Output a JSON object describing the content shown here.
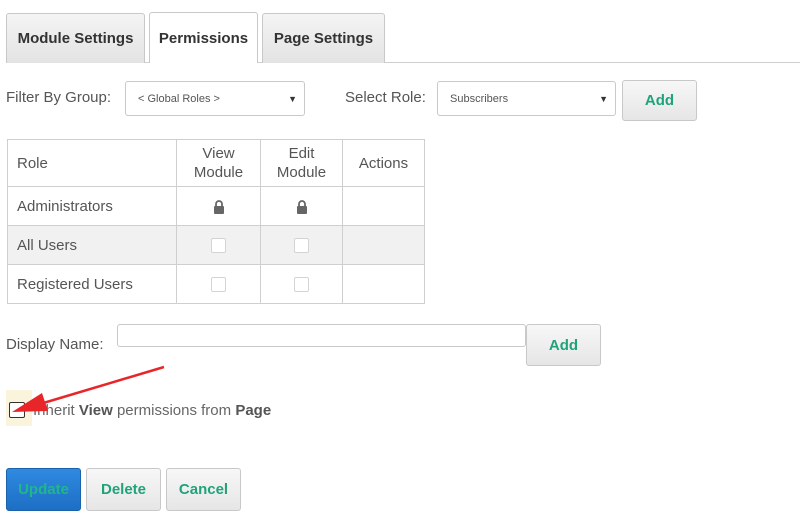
{
  "tabs": [
    {
      "label": "Module Settings",
      "active": false
    },
    {
      "label": "Permissions",
      "active": true
    },
    {
      "label": "Page Settings",
      "active": false
    }
  ],
  "filter": {
    "label": "Filter By Group:",
    "value": "< Global Roles >",
    "select_role_label": "Select Role:",
    "role_value": "Subscribers",
    "add_label": "Add"
  },
  "table": {
    "headers": {
      "role": "Role",
      "view_line1": "View",
      "view_line2": "Module",
      "edit_line1": "Edit",
      "edit_line2": "Module",
      "actions": "Actions"
    },
    "rows": [
      {
        "role": "Administrators",
        "view": "locked",
        "edit": "locked"
      },
      {
        "role": "All Users",
        "view": "unchecked",
        "edit": "unchecked"
      },
      {
        "role": "Registered Users",
        "view": "unchecked",
        "edit": "unchecked"
      }
    ]
  },
  "display_name": {
    "label": "Display Name:",
    "value": "",
    "add_label": "Add"
  },
  "inherit": {
    "prefix": "Inherit ",
    "bold1": "View",
    "middle": " permissions from ",
    "bold2": "Page",
    "checked": false
  },
  "actions": {
    "update": "Update",
    "delete": "Delete",
    "cancel": "Cancel"
  },
  "colors": {
    "accent_text": "#1fa37b",
    "primary_button": "#1d6fc4",
    "annotation_arrow": "#e8262a",
    "highlight": "#fbf4dc"
  }
}
